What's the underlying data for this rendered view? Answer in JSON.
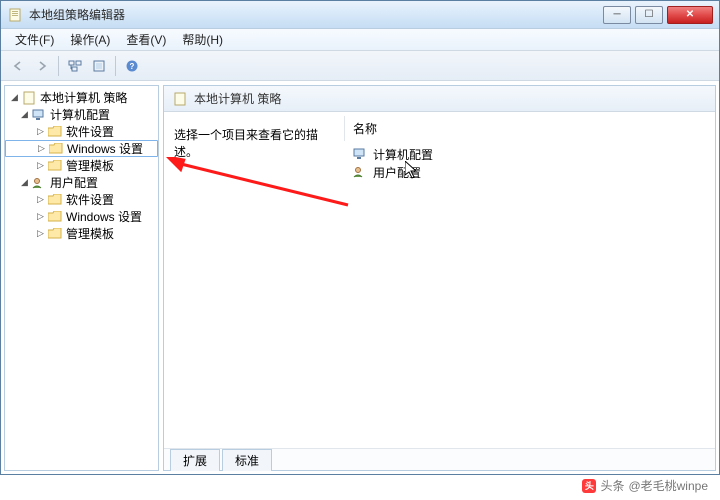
{
  "window": {
    "title": "本地组策略编辑器"
  },
  "menu": {
    "file": "文件(F)",
    "action": "操作(A)",
    "view": "查看(V)",
    "help": "帮助(H)"
  },
  "tree": {
    "root": "本地计算机 策略",
    "computer_config": "计算机配置",
    "cc_software": "软件设置",
    "cc_windows": "Windows 设置",
    "cc_admin": "管理模板",
    "user_config": "用户配置",
    "uc_software": "软件设置",
    "uc_windows": "Windows 设置",
    "uc_admin": "管理模板"
  },
  "right": {
    "header": "本地计算机 策略",
    "description_prompt": "选择一个项目来查看它的描述。",
    "column_name": "名称",
    "items": {
      "computer_config": "计算机配置",
      "user_config": "用户配置"
    }
  },
  "tabs": {
    "extended": "扩展",
    "standard": "标准"
  },
  "watermark": {
    "prefix": "头条",
    "text": "@老毛桃winpe"
  }
}
